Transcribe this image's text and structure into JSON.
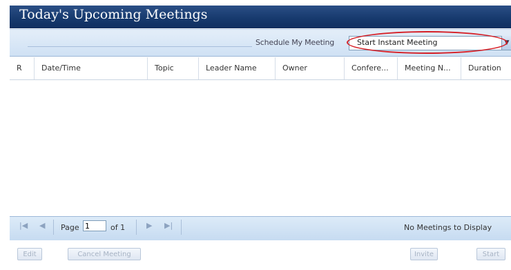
{
  "header": {
    "title": "Today's Upcoming Meetings"
  },
  "toolbar": {
    "schedule_label": "Schedule My Meeting",
    "meeting_select": {
      "selected": "Start Instant Meeting",
      "arrow_icon": "chevron-down-icon"
    },
    "highlight_color": "#d61f26"
  },
  "grid": {
    "columns": [
      "R",
      "Date/Time",
      "Topic",
      "Leader Name",
      "Owner",
      "Confere...",
      "Meeting N...",
      "Duration"
    ],
    "rows": []
  },
  "pager": {
    "icons": [
      "first-page-icon",
      "prev-page-icon",
      "next-page-icon",
      "last-page-icon"
    ],
    "page_label": "Page",
    "page_value": "1",
    "of_label": "of 1",
    "status": "No Meetings to Display"
  },
  "actions": {
    "edit": "Edit",
    "cancel": "Cancel Meeting",
    "invite": "Invite",
    "start": "Start"
  }
}
